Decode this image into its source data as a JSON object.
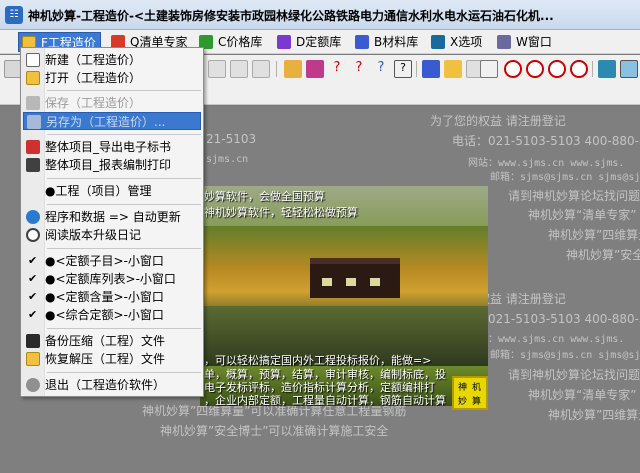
{
  "window": {
    "title": "神机妙算-工程造价-<土建装饰房修安装市政园林绿化公路铁路电力通信水利水电水运石油石化机..."
  },
  "menubar": {
    "items": [
      {
        "label": "F工程造价",
        "icon": "folder-icon",
        "color": "#3a7ad6"
      },
      {
        "label": "Q清单专家",
        "icon": "cube-icon",
        "color": "#d83a2a"
      },
      {
        "label": "C价格库",
        "icon": "cube-icon",
        "color": "#2e9a2e"
      },
      {
        "label": "D定额库",
        "icon": "cube-icon",
        "color": "#7a3ad0"
      },
      {
        "label": "B材料库",
        "icon": "cube-icon",
        "color": "#3a5ad0"
      },
      {
        "label": "X选项",
        "icon": "tools-icon",
        "color": "#1a6a9a"
      },
      {
        "label": "W窗口",
        "icon": "window-icon",
        "color": "#6a6aa0"
      }
    ]
  },
  "dropdown": {
    "items": [
      {
        "label": "新建（工程造价）",
        "type": "item",
        "icon": "new-file-icon",
        "state": "normal"
      },
      {
        "label": "打开（工程造价）",
        "type": "item",
        "icon": "open-folder-icon",
        "state": "normal"
      },
      {
        "label": "保存（工程造价）",
        "type": "item",
        "icon": "save-icon",
        "state": "disabled"
      },
      {
        "label": "另存为（工程造价）...",
        "type": "item",
        "icon": "save-as-icon",
        "state": "highlight"
      },
      {
        "label": "整体项目_导出电子标书",
        "type": "item",
        "icon": "export-icon",
        "state": "normal"
      },
      {
        "label": "整体项目_报表编制打印",
        "type": "item",
        "icon": "print-icon",
        "state": "normal"
      },
      {
        "label": "●工程（项目）管理",
        "type": "item",
        "icon": "",
        "state": "normal"
      },
      {
        "label": "程序和数据 => 自动更新",
        "type": "item",
        "icon": "globe-icon",
        "state": "normal"
      },
      {
        "label": "阅读版本升级日记",
        "type": "item",
        "icon": "magnifier-icon",
        "state": "normal"
      },
      {
        "label": "●<定额子目>-小窗口",
        "type": "check",
        "icon": "",
        "state": "checked"
      },
      {
        "label": "●<定额库列表>-小窗口",
        "type": "check",
        "icon": "",
        "state": "checked"
      },
      {
        "label": "●<定额含量>-小窗口",
        "type": "check",
        "icon": "",
        "state": "checked"
      },
      {
        "label": "●<综合定额>-小窗口",
        "type": "check",
        "icon": "",
        "state": "checked"
      },
      {
        "label": "备份压缩（工程）文件",
        "type": "item",
        "icon": "archive-icon",
        "state": "normal"
      },
      {
        "label": "恢复解压（工程）文件",
        "type": "item",
        "icon": "folder-icon",
        "state": "normal"
      },
      {
        "label": "退出（工程造价软件）",
        "type": "item",
        "icon": "exit-icon",
        "state": "normal"
      }
    ]
  },
  "watermark": {
    "lines": [
      "为了您的权益  请注册登记",
      "电话：021-5103-5103  400-880-51",
      "网站：www.sjms.cn  www.sjms.",
      "邮箱：sjms@sjms.cn  sjms@sjms",
      "请到神机妙算论坛找问题",
      "神机妙算“清单专家”",
      "神机妙算”四维算量",
      "神机妙算”安全",
      "为了您的权益  请注册登记",
      "电话：021-5103-5103  400-880-510",
      "网站：www.sjms.cn  www.sjms.",
      "邮箱：sjms@sjms.cn  sjms@sjms",
      "请到神机妙算论坛找问题",
      "神机妙算“清单专家”",
      "神机妙算”四维算量",
      "神机妙算”四维算量”可以准确计算任意工程量钢筋",
      "神机妙算”安全博士”可以准确计算施工安全"
    ],
    "left_fragments": [
      "21-5103",
      "sjms.cn"
    ],
    "photo_captions": [
      "妙算软件，会做全国预算",
      "神机妙算软件，轻轻松松做预算",
      "，可以轻松搞定国内外工程投标报价，能做=>",
      "单，概算，预算，结算，审计审核，编制标底，投",
      "电子发标评标，造价指标计算分析，定额编排打",
      "，企业内部定额，工程量自动计算，钢筋自动计算"
    ],
    "seal_text": [
      "神",
      "机",
      "妙",
      "算"
    ]
  }
}
